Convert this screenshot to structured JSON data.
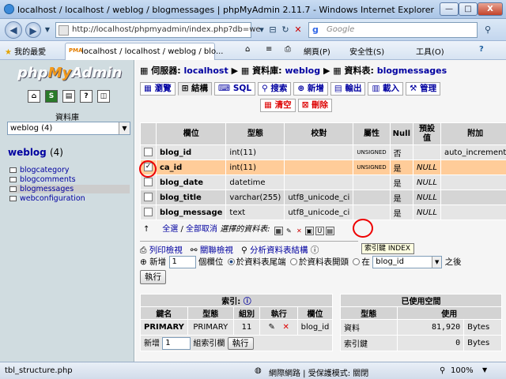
{
  "window": {
    "title": "localhost / localhost / weblog / blogmessages | phpMyAdmin 2.11.7 - Windows Internet Explorer",
    "min": "—",
    "max": "□",
    "close": "X"
  },
  "nav": {
    "back": "◀",
    "forward": "▶",
    "url": "http://localhost/phpmyadmin/index.php?db=we",
    "search_placeholder": "Google"
  },
  "favbar": {
    "favorites": "我的最愛",
    "tab_title": "localhost / localhost / weblog / blo...",
    "page_menu": "網頁(P)",
    "safety_menu": "安全性(S)",
    "tools_menu": "工具(O)",
    "help_icon": "?"
  },
  "left": {
    "logo_php": "php",
    "logo_my": "My",
    "logo_admin": "Admin",
    "db_label": "資料庫",
    "db_selected": "weblog (4)",
    "db_heading": "weblog",
    "db_count": "(4)",
    "tables": [
      "blogcategory",
      "blogcomments",
      "blogmessages",
      "webconfiguration"
    ]
  },
  "crumb": {
    "server_label": "伺服器:",
    "server": "localhost",
    "db_label": "資料庫:",
    "db": "weblog",
    "table_label": "資料表:",
    "table": "blogmessages"
  },
  "tabs": {
    "browse": "瀏覽",
    "structure": "結構",
    "sql": "SQL",
    "search": "搜索",
    "insert": "新增",
    "export": "輸出",
    "import": "載入",
    "operations": "管理",
    "empty": "清空",
    "drop": "刪除"
  },
  "structure": {
    "headers": [
      "欄位",
      "型態",
      "校對",
      "屬性",
      "Null",
      "預設值",
      "附加"
    ],
    "rows": [
      {
        "name": "blog_id",
        "type": "int(11)",
        "collation": "",
        "attr": "UNSIGNED",
        "null": "否",
        "default": "",
        "extra": "auto_increment"
      },
      {
        "name": "ca_id",
        "type": "int(11)",
        "collation": "",
        "attr": "UNSIGNED",
        "null": "是",
        "default": "NULL",
        "extra": ""
      },
      {
        "name": "blog_date",
        "type": "datetime",
        "collation": "",
        "attr": "",
        "null": "是",
        "default": "NULL",
        "extra": ""
      },
      {
        "name": "blog_title",
        "type": "varchar(255)",
        "collation": "utf8_unicode_ci",
        "attr": "",
        "null": "是",
        "default": "NULL",
        "extra": ""
      },
      {
        "name": "blog_message",
        "type": "text",
        "collation": "utf8_unicode_ci",
        "attr": "",
        "null": "是",
        "default": "NULL",
        "extra": ""
      }
    ],
    "check_all": "全選",
    "separator": "/",
    "uncheck_all": "全部取消",
    "with_selected": "選擇的資料表:",
    "tooltip": "索引鍵 INDEX"
  },
  "actions": {
    "print_view": "列印檢視",
    "relation_view": "關聯檢視",
    "propose_structure": "分析資料表結構",
    "add_label": "新增",
    "add_count": "1",
    "fields_label": "個欄位",
    "at_end": "於資料表尾端",
    "at_begin": "於資料表開頭",
    "after_prefix": "在",
    "after_field": "blog_id",
    "after_suffix": "之後",
    "go": "執行"
  },
  "indexes": {
    "title": "索引:",
    "headers": [
      "鍵名",
      "型態",
      "組別",
      "執行",
      "欄位"
    ],
    "row": {
      "keyname": "PRIMARY",
      "type": "PRIMARY",
      "cardinality": "11",
      "field": "blog_id"
    },
    "add_label": "新增",
    "add_count": "1",
    "cols_label": "組索引欄",
    "go": "執行"
  },
  "space": {
    "title": "已使用空間",
    "headers": [
      "型態",
      "使用"
    ],
    "rows": [
      {
        "type": "資料",
        "value": "81,920",
        "unit": "Bytes"
      },
      {
        "type": "索引鍵",
        "value": "0",
        "unit": "Bytes"
      }
    ]
  },
  "status": {
    "left": "tbl_structure.php",
    "zone": "網際網路 | 受保護模式: 關閉",
    "zoom": "100%"
  },
  "colors": {
    "marked_row": "#ffcc99",
    "link": "#0000a0",
    "annotation": "#e00000"
  }
}
